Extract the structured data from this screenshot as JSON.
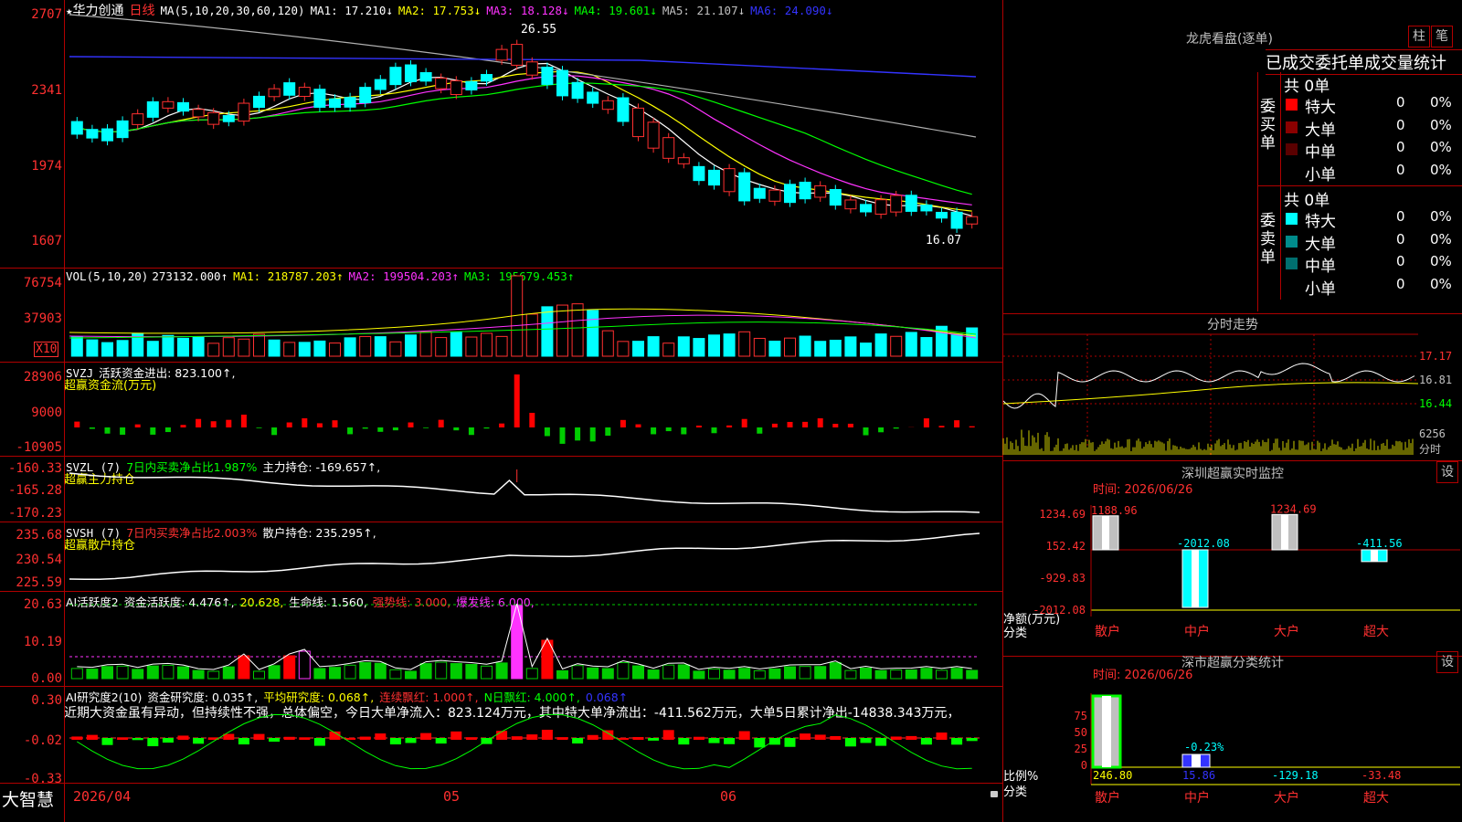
{
  "stock": {
    "star": "★",
    "name": "华力创通",
    "period": "日线",
    "ma_params": "MA(5,10,20,30,60,120)"
  },
  "ma_values": [
    {
      "label": "MA1: 17.210↓",
      "color": "#ffffff"
    },
    {
      "label": "MA2: 17.753↓",
      "color": "#ffff00"
    },
    {
      "label": "MA3: 18.128↓",
      "color": "#ff33ff"
    },
    {
      "label": "MA4: 19.601↓",
      "color": "#00ff00"
    },
    {
      "label": "MA5: 21.107↓",
      "color": "#c0c0c0"
    },
    {
      "label": "MA6: 24.090↓",
      "color": "#3333ff"
    }
  ],
  "price_axis": [
    "2707",
    "2341",
    "1974",
    "1607"
  ],
  "price_annotations": {
    "high": "26.55",
    "low": "16.07"
  },
  "vol": {
    "title": "VOL(5,10,20)",
    "value": "273132.000↑",
    "ma1": "MA1: 218787.203↑",
    "ma2": "MA2: 199504.203↑",
    "ma3": "MA3: 195679.453↑",
    "axis": [
      "76754",
      "37903"
    ],
    "unit": "X10"
  },
  "svzj": {
    "title": "SVZJ",
    "label": "活跃资金进出: 823.100↑,",
    "sub": "超赢资金流(万元)",
    "axis": [
      "28906",
      "9000",
      "-10905"
    ]
  },
  "svzl": {
    "title": "SVZL (7)",
    "ratio": "7日内买卖净占比1.987%",
    "hold": "主力持仓: -169.657↑,",
    "sub": "超赢主力持仓",
    "axis": [
      "-160.33",
      "-165.28",
      "-170.23"
    ]
  },
  "svsh": {
    "title": "SVSH (7)",
    "ratio": "7日内买卖净占比2.003%",
    "hold": "散户持仓: 235.295↑,",
    "sub": "超赢散户持仓",
    "axis": [
      "235.68",
      "230.54",
      "225.59"
    ]
  },
  "ai1": {
    "title": "AI活跃度2",
    "act": "资金活跃度: 4.476↑,",
    "v2": "20.628,",
    "life": "生命线: 1.560,",
    "strong": "强势线: 3.000,",
    "burst": "爆发线: 6.000,",
    "axis": [
      "20.63",
      "10.19",
      "0.00"
    ]
  },
  "ai2": {
    "title": "AI研究度2(10)",
    "fund": "资金研究度: 0.035↑,",
    "avg": "平均研究度: 0.068↑,",
    "cont": "连续飘红: 1.000↑,",
    "nday": "N日飘红: 4.000↑,",
    "v5": "0.068↑",
    "text": "近期大资金虽有异动，但持续性不强，总体偏空，今日大单净流入：823.124万元，其中特大单净流出：-411.562万元，大单5日累计净出-14838.343万元，",
    "axis": [
      "0.30",
      "-0.02",
      "-0.33"
    ]
  },
  "bottom": {
    "brand": "大智慧",
    "date": "2026/04",
    "m05": "05",
    "m06": "06"
  },
  "lhb": {
    "title": "龙虎看盘(逐单)",
    "btn1": "柱",
    "btn2": "笔",
    "tabs": "已成交委托单成交量统计",
    "buy_label": "委买单",
    "sell_label": "委卖单",
    "buy_total": "共 0单",
    "sell_total": "共 0单",
    "buy_rows": [
      {
        "name": "特大",
        "count": "0",
        "pct": "0%",
        "color": "#ff0000"
      },
      {
        "name": "大单",
        "count": "0",
        "pct": "0%",
        "color": "#8b0000"
      },
      {
        "name": "中单",
        "count": "0",
        "pct": "0%",
        "color": "#5a0000"
      },
      {
        "name": "小单",
        "count": "0",
        "pct": "0%",
        "color": ""
      }
    ],
    "sell_rows": [
      {
        "name": "特大",
        "count": "0",
        "pct": "0%",
        "color": "#00ffff"
      },
      {
        "name": "大单",
        "count": "0",
        "pct": "0%",
        "color": "#008b8b"
      },
      {
        "name": "中单",
        "count": "0",
        "pct": "0%",
        "color": "#006f6f"
      },
      {
        "name": "小单",
        "count": "0",
        "pct": "0%",
        "color": ""
      }
    ]
  },
  "fenshi": {
    "title": "分时走势",
    "axis": [
      "17.17",
      "16.81",
      "16.44",
      "6256",
      "分时"
    ]
  },
  "monitor": {
    "title": "深圳超赢实时监控",
    "btn": "设",
    "time": "时间: 2026/06/26",
    "axis": [
      "1234.69",
      "152.42",
      "-929.83",
      "-2012.08"
    ],
    "ylabel": "净额(万元)",
    "xlabel": "分类",
    "bars": [
      {
        "label": "1188.96",
        "cat": "散户",
        "value": 1188.96
      },
      {
        "label": "-2012.08",
        "cat": "中户",
        "value": -2012.08
      },
      {
        "label": "1234.69",
        "cat": "大户",
        "value": 1234.69
      },
      {
        "label": "-411.56",
        "cat": "超大",
        "value": -411.56
      }
    ]
  },
  "classify": {
    "title": "深市超赢分类统计",
    "btn": "设",
    "time": "时间: 2026/06/26",
    "axis": [
      "75",
      "50",
      "25",
      "0"
    ],
    "ylabel": "比例%",
    "xlabel": "分类",
    "bars": [
      {
        "label": "246.80",
        "cat": "散户",
        "value": 100
      },
      {
        "label": "-0.23%",
        "cat": "中户",
        "value": 12
      },
      {
        "label": "15.86",
        "cat": "",
        "value": 0
      },
      {
        "label": "-129.18",
        "cat": "大户",
        "value": 0
      },
      {
        "label": "-33.48",
        "cat": "超大",
        "value": 0
      }
    ]
  }
}
